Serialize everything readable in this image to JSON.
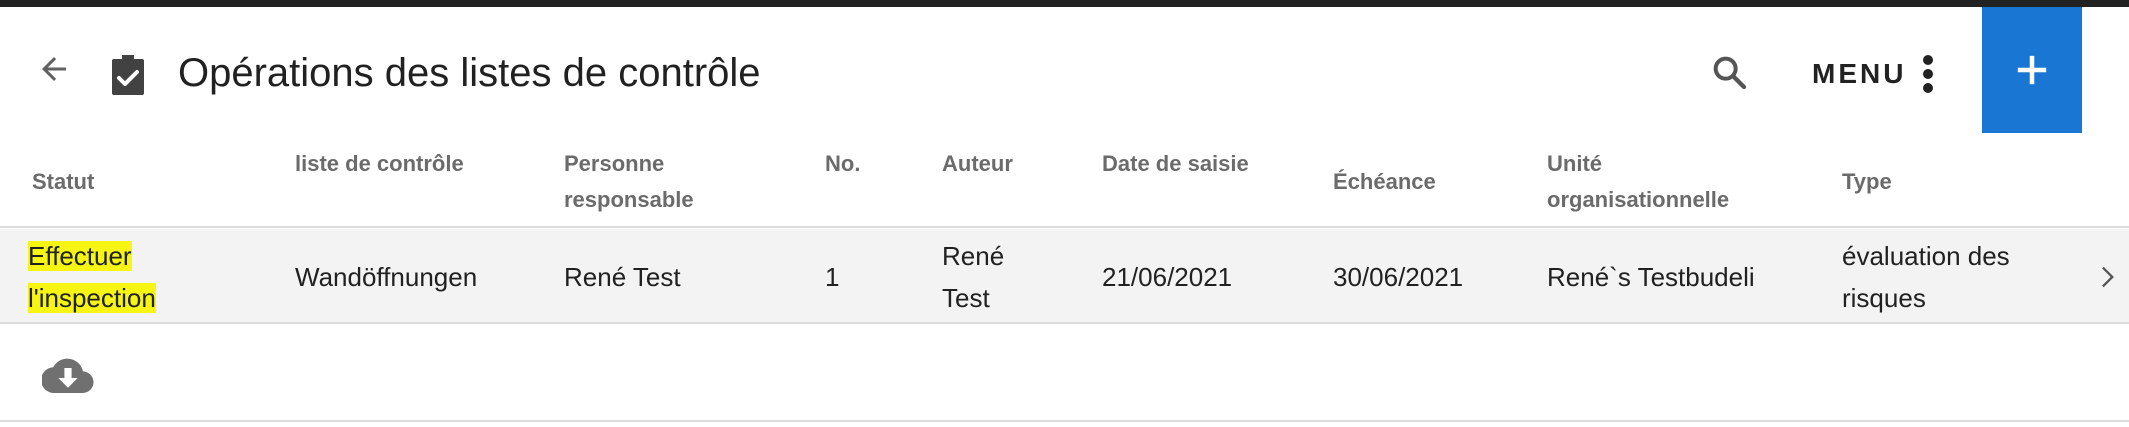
{
  "header": {
    "title": "Opérations des listes de contrôle",
    "back_icon": "arrow-left-icon",
    "page_icon": "clipboard-check-icon",
    "search_icon": "search-icon",
    "menu_label": "MENU",
    "menu_icon": "more-vertical-icon",
    "add_icon": "plus-icon",
    "accent_color": "#1976d2"
  },
  "table": {
    "columns": [
      {
        "line1": "Statut",
        "line2": ""
      },
      {
        "line1": "liste de contrôle",
        "line2": ""
      },
      {
        "line1": "Personne",
        "line2": "responsable"
      },
      {
        "line1": "No.",
        "line2": ""
      },
      {
        "line1": "Auteur",
        "line2": ""
      },
      {
        "line1": "Date de saisie",
        "line2": ""
      },
      {
        "line1": "Échéance",
        "line2": ""
      },
      {
        "line1": "Unité",
        "line2": "organisationnelle"
      },
      {
        "line1": "Type",
        "line2": ""
      }
    ],
    "rows": [
      {
        "status_line1": "Effectuer",
        "status_line2": "l'inspection",
        "checklist": "Wandöffnungen",
        "responsible": "René Test",
        "number": "1",
        "author_line1": "René",
        "author_line2": "Test",
        "entry_date": "21/06/2021",
        "due_date": "30/06/2021",
        "org_unit": "René`s Testbudeli",
        "type_line1": "évaluation des",
        "type_line2": "risques",
        "chevron_icon": "chevron-right-icon",
        "status_highlight_color": "#f6f513"
      }
    ]
  },
  "footer": {
    "download_icon": "cloud-download-icon"
  }
}
